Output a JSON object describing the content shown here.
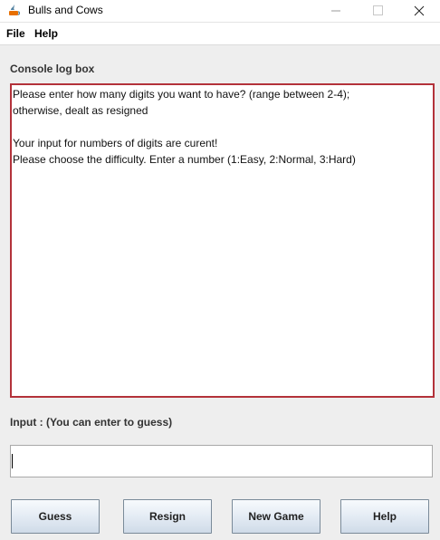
{
  "window": {
    "title": "Bulls and Cows",
    "icon": "java-app-icon"
  },
  "menubar": {
    "items": [
      {
        "label": "File"
      },
      {
        "label": "Help"
      }
    ]
  },
  "console": {
    "label": "Console log box",
    "lines": [
      "Please enter how many digits you want to have? (range between 2-4);",
      "otherwise, dealt as resigned",
      "",
      "Your input for numbers of digits are curent!",
      "Please choose the difficulty. Enter a number (1:Easy, 2:Normal, 3:Hard)"
    ],
    "border_color": "#b3323a"
  },
  "input": {
    "label": "Input : (You can enter to guess)",
    "value": ""
  },
  "buttons": {
    "guess": "Guess",
    "resign": "Resign",
    "new_game": "New Game",
    "help": "Help"
  }
}
